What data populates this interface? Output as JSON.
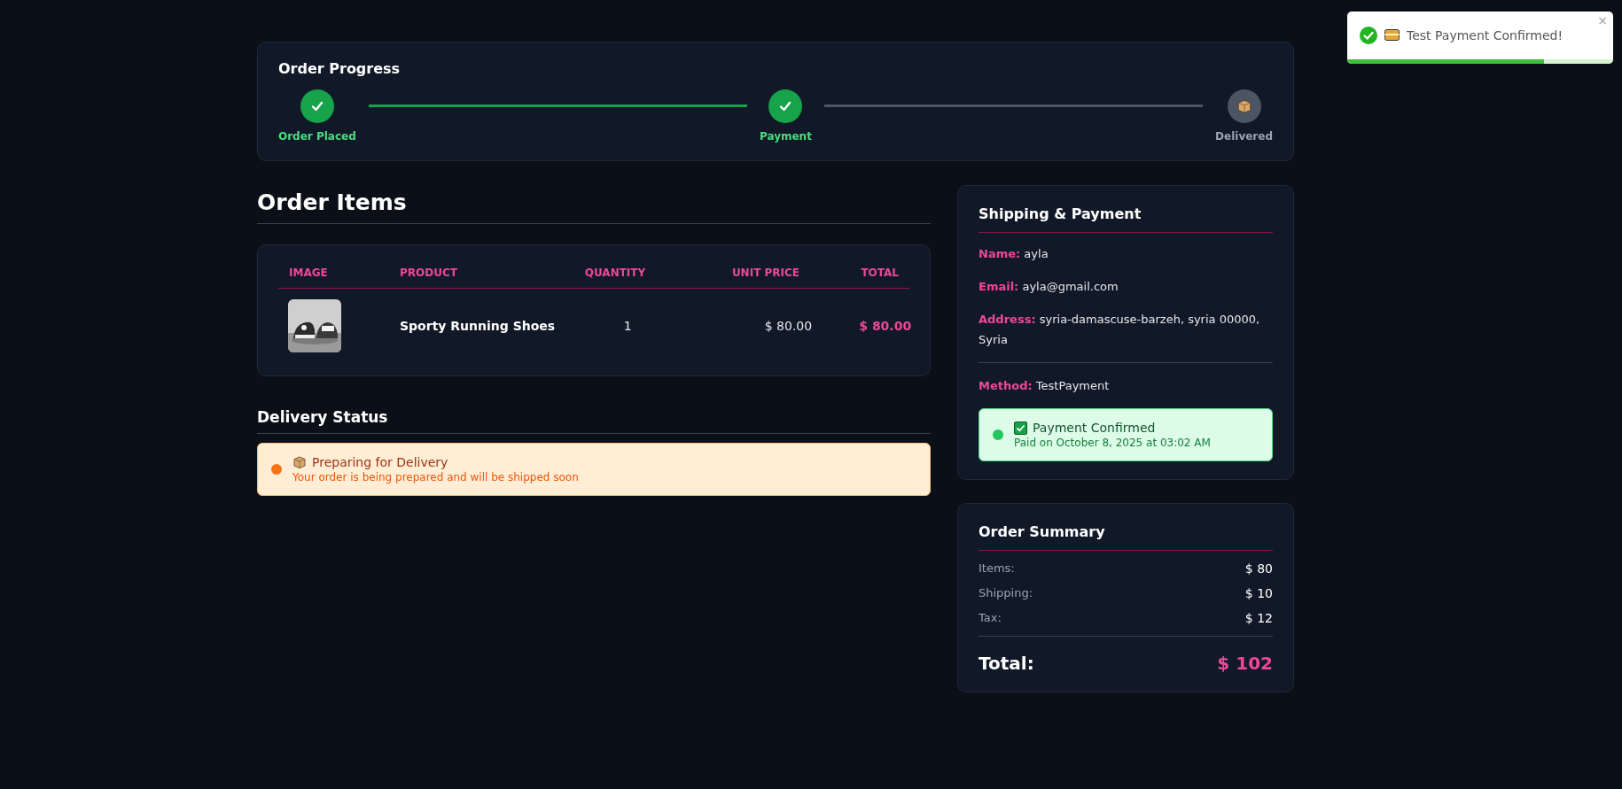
{
  "toast": {
    "text": "Test Payment Confirmed!",
    "close": "×",
    "level": 0.74
  },
  "progress": {
    "title": "Order Progress",
    "steps": [
      {
        "label": "Order Placed",
        "done": true,
        "kind": "check"
      },
      {
        "label": "Payment",
        "done": true,
        "kind": "check"
      },
      {
        "label": "Delivered",
        "done": false,
        "kind": "box"
      }
    ]
  },
  "order_items": {
    "title": "Order Items",
    "columns": [
      "IMAGE",
      "PRODUCT",
      "QUANTITY",
      "UNIT PRICE",
      "TOTAL"
    ],
    "rows": [
      {
        "product": "Sporty Running Shoes",
        "quantity": "1",
        "unit_price": "$ 80.00",
        "total": "$ 80.00"
      }
    ]
  },
  "delivery_status": {
    "title": "Delivery Status",
    "status": {
      "title": "Preparing for Delivery",
      "subtitle": "Your order is being prepared and will be shipped soon"
    }
  },
  "shipping_payment": {
    "title": "Shipping & Payment",
    "shipping": [
      {
        "label": "Name:",
        "value": "ayla"
      },
      {
        "label": "Email:",
        "value": "ayla@gmail.com"
      },
      {
        "label": "Address:",
        "value": "syria-damascuse-barzeh, syria 00000, Syria"
      }
    ],
    "payment": [
      {
        "label": "Method:",
        "value": "TestPayment"
      }
    ],
    "status": {
      "title": "Payment Confirmed",
      "subtitle": "Paid on October 8, 2025 at 03:02 AM"
    }
  },
  "summary": {
    "title": "Order Summary",
    "rows": [
      {
        "label": "Items:",
        "value": "$ 80"
      },
      {
        "label": "Shipping:",
        "value": "$ 10"
      },
      {
        "label": "Tax:",
        "value": "$ 12"
      }
    ],
    "total": {
      "label": "Total:",
      "value": "$ 102"
    }
  }
}
